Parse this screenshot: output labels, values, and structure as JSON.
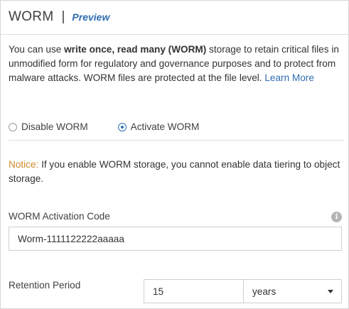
{
  "header": {
    "title": "WORM",
    "separator": "|",
    "badge": "Preview"
  },
  "description": {
    "intro": "You can use ",
    "bold": "write once, read many (WORM)",
    "rest": " storage to retain critical files in unmodified form for regulatory and governance purposes and to protect from malware attacks. WORM files are protected at the file level.",
    "link": "Learn More"
  },
  "mode": {
    "options": [
      {
        "label": "Disable WORM",
        "selected": false
      },
      {
        "label": "Activate WORM",
        "selected": true
      }
    ]
  },
  "notice": {
    "label": "Notice:",
    "text": " If you enable WORM storage, you cannot enable data tiering to object storage."
  },
  "activation_code": {
    "label": "WORM Activation Code",
    "value": "Worm-1111122222aaaaa",
    "info_icon": "info-icon"
  },
  "retention": {
    "label": "Retention Period",
    "value": "15",
    "unit": "years"
  },
  "colors": {
    "accent": "#2f6db3",
    "notice": "#d08a2a",
    "border": "#cfcfcf"
  }
}
